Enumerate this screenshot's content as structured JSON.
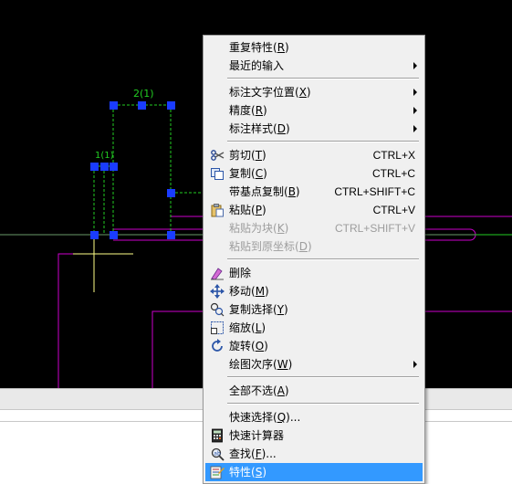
{
  "menu": {
    "items": [
      {
        "label": "重复特性(R)",
        "hotkey": "R",
        "shortcut": "",
        "submenu": false,
        "disabled": false,
        "icon": ""
      },
      {
        "label": "最近的输入",
        "hotkey": "",
        "shortcut": "",
        "submenu": true,
        "disabled": false,
        "icon": ""
      },
      {
        "label": "标注文字位置(X)",
        "hotkey": "X",
        "shortcut": "",
        "submenu": true,
        "disabled": false,
        "icon": ""
      },
      {
        "label": "精度(R)",
        "hotkey": "R",
        "shortcut": "",
        "submenu": true,
        "disabled": false,
        "icon": ""
      },
      {
        "label": "标注样式(D)",
        "hotkey": "D",
        "shortcut": "",
        "submenu": true,
        "disabled": false,
        "icon": ""
      },
      {
        "label": "剪切(T)",
        "hotkey": "T",
        "shortcut": "CTRL+X",
        "submenu": false,
        "disabled": false,
        "icon": "scissors-icon"
      },
      {
        "label": "复制(C)",
        "hotkey": "C",
        "shortcut": "CTRL+C",
        "submenu": false,
        "disabled": false,
        "icon": "copy-icon"
      },
      {
        "label": "带基点复制(B)",
        "hotkey": "B",
        "shortcut": "CTRL+SHIFT+C",
        "submenu": false,
        "disabled": false,
        "icon": ""
      },
      {
        "label": "粘贴(P)",
        "hotkey": "P",
        "shortcut": "CTRL+V",
        "submenu": false,
        "disabled": false,
        "icon": "paste-icon"
      },
      {
        "label": "粘贴为块(K)",
        "hotkey": "K",
        "shortcut": "CTRL+SHIFT+V",
        "submenu": false,
        "disabled": true,
        "icon": ""
      },
      {
        "label": "粘贴到原坐标(D)",
        "hotkey": "D",
        "shortcut": "",
        "submenu": false,
        "disabled": true,
        "icon": ""
      },
      {
        "label": "删除",
        "hotkey": "",
        "shortcut": "",
        "submenu": false,
        "disabled": false,
        "icon": "eraser-icon"
      },
      {
        "label": "移动(M)",
        "hotkey": "M",
        "shortcut": "",
        "submenu": false,
        "disabled": false,
        "icon": "move-icon"
      },
      {
        "label": "复制选择(Y)",
        "hotkey": "Y",
        "shortcut": "",
        "submenu": false,
        "disabled": false,
        "icon": "copy-selection-icon"
      },
      {
        "label": "缩放(L)",
        "hotkey": "L",
        "shortcut": "",
        "submenu": false,
        "disabled": false,
        "icon": "scale-icon"
      },
      {
        "label": "旋转(O)",
        "hotkey": "O",
        "shortcut": "",
        "submenu": false,
        "disabled": false,
        "icon": "rotate-icon"
      },
      {
        "label": "绘图次序(W)",
        "hotkey": "W",
        "shortcut": "",
        "submenu": true,
        "disabled": false,
        "icon": ""
      },
      {
        "label": "全部不选(A)",
        "hotkey": "A",
        "shortcut": "",
        "submenu": false,
        "disabled": false,
        "icon": ""
      },
      {
        "label": "快速选择(Q)...",
        "hotkey": "Q",
        "shortcut": "",
        "submenu": false,
        "disabled": false,
        "icon": ""
      },
      {
        "label": "快速计算器",
        "hotkey": "",
        "shortcut": "",
        "submenu": false,
        "disabled": false,
        "icon": "calculator-icon"
      },
      {
        "label": "查找(F)...",
        "hotkey": "F",
        "shortcut": "",
        "submenu": false,
        "disabled": false,
        "icon": "find-icon"
      },
      {
        "label": "特性(S)",
        "hotkey": "S",
        "shortcut": "",
        "submenu": false,
        "disabled": false,
        "highlighted": true,
        "icon": "properties-icon"
      }
    ]
  },
  "colors": {
    "canvas_background": "#000000",
    "grip": "#1a3cff",
    "dimension_line": "#22cc22",
    "magenta_line": "#cc00cc",
    "crosshair": "#ffff88",
    "highlight": "#3399ff"
  },
  "canvas": {
    "dim_text_top": "2(1)",
    "dim_text_left": "1(1)"
  }
}
